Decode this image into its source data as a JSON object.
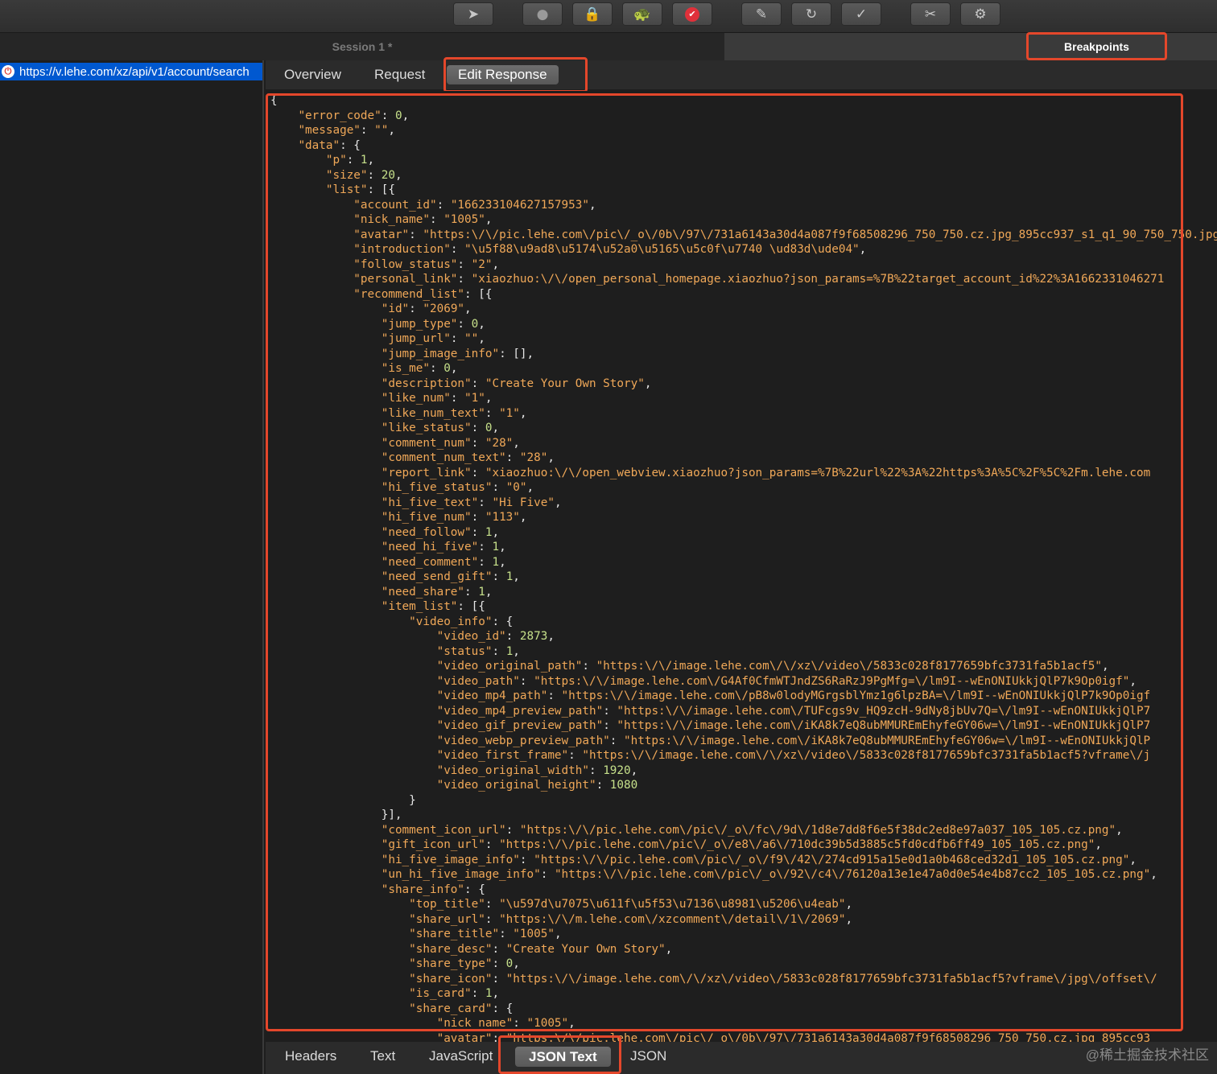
{
  "toolbar": {
    "buttons": [
      {
        "name": "pointer-icon",
        "glyph": "➤"
      },
      {
        "name": "record-icon",
        "glyph": "●"
      },
      {
        "name": "ssl-lock-icon",
        "glyph": "🔒"
      },
      {
        "name": "throttle-turtle-icon",
        "glyph": "🐢"
      },
      {
        "name": "breakpoint-stop-icon",
        "glyph": "✔"
      },
      {
        "name": "edit-pen-icon",
        "glyph": "✎"
      },
      {
        "name": "repeat-icon",
        "glyph": "↻"
      },
      {
        "name": "validate-check-icon",
        "glyph": "✓"
      },
      {
        "name": "tools-icon",
        "glyph": "✂"
      },
      {
        "name": "settings-gear-icon",
        "glyph": "⚙"
      }
    ]
  },
  "session_tab": "Session 1 *",
  "breakpoints_tab": "Breakpoints",
  "sidebar": {
    "url": "https://v.lehe.com/xz/api/v1/account/search",
    "status_icon": "⏻"
  },
  "subtabs": {
    "overview": "Overview",
    "request": "Request",
    "edit_response": "Edit Response"
  },
  "editor": {
    "lines": [
      "{",
      "    \"error_code\": 0,",
      "    \"message\": \"\",",
      "    \"data\": {",
      "        \"p\": 1,",
      "        \"size\": 20,",
      "        \"list\": [{",
      "            \"account_id\": \"166233104627157953\",",
      "            \"nick_name\": \"1005\",",
      "            \"avatar\": \"https:\\/\\/pic.lehe.com\\/pic\\/_o\\/0b\\/97\\/731a6143a30d4a087f9f68508296_750_750.cz.jpg_895cc937_s1_q1_90_750_750.jpg\",",
      "            \"introduction\": \"\\u5f88\\u9ad8\\u5174\\u52a0\\u5165\\u5c0f\\u7740 \\ud83d\\ude04\",",
      "            \"follow_status\": \"2\",",
      "            \"personal_link\": \"xiaozhuo:\\/\\/open_personal_homepage.xiaozhuo?json_params=%7B%22target_account_id%22%3A1662331046271",
      "            \"recommend_list\": [{",
      "                \"id\": \"2069\",",
      "                \"jump_type\": 0,",
      "                \"jump_url\": \"\",",
      "                \"jump_image_info\": [],",
      "                \"is_me\": 0,",
      "                \"description\": \"Create Your Own Story\",",
      "                \"like_num\": \"1\",",
      "                \"like_num_text\": \"1\",",
      "                \"like_status\": 0,",
      "                \"comment_num\": \"28\",",
      "                \"comment_num_text\": \"28\",",
      "                \"report_link\": \"xiaozhuo:\\/\\/open_webview.xiaozhuo?json_params=%7B%22url%22%3A%22https%3A%5C%2F%5C%2Fm.lehe.com",
      "                \"hi_five_status\": \"0\",",
      "                \"hi_five_text\": \"Hi Five\",",
      "                \"hi_five_num\": \"113\",",
      "                \"need_follow\": 1,",
      "                \"need_hi_five\": 1,",
      "                \"need_comment\": 1,",
      "                \"need_send_gift\": 1,",
      "                \"need_share\": 1,",
      "                \"item_list\": [{",
      "                    \"video_info\": {",
      "                        \"video_id\": 2873,",
      "                        \"status\": 1,",
      "                        \"video_original_path\": \"https:\\/\\/image.lehe.com\\/\\/xz\\/video\\/5833c028f8177659bfc3731fa5b1acf5\",",
      "                        \"video_path\": \"https:\\/\\/image.lehe.com\\/G4Af0CfmWTJndZS6RaRzJ9PgMfg=\\/lm9I--wEnONIUkkjQlP7k9Op0igf\",",
      "                        \"video_mp4_path\": \"https:\\/\\/image.lehe.com\\/pB8w0lodyMGrgsblYmz1g6lpzBA=\\/lm9I--wEnONIUkkjQlP7k9Op0igf",
      "                        \"video_mp4_preview_path\": \"https:\\/\\/image.lehe.com\\/TUFcgs9v_HQ9zcH-9dNy8jbUv7Q=\\/lm9I--wEnONIUkkjQlP7",
      "                        \"video_gif_preview_path\": \"https:\\/\\/image.lehe.com\\/iKA8k7eQ8ubMMUREmEhyfeGY06w=\\/lm9I--wEnONIUkkjQlP7",
      "                        \"video_webp_preview_path\": \"https:\\/\\/image.lehe.com\\/iKA8k7eQ8ubMMUREmEhyfeGY06w=\\/lm9I--wEnONIUkkjQlP",
      "                        \"video_first_frame\": \"https:\\/\\/image.lehe.com\\/\\/xz\\/video\\/5833c028f8177659bfc3731fa5b1acf5?vframe\\/j",
      "                        \"video_original_width\": 1920,",
      "                        \"video_original_height\": 1080",
      "                    }",
      "                }],",
      "                \"comment_icon_url\": \"https:\\/\\/pic.lehe.com\\/pic\\/_o\\/fc\\/9d\\/1d8e7dd8f6e5f38dc2ed8e97a037_105_105.cz.png\",",
      "                \"gift_icon_url\": \"https:\\/\\/pic.lehe.com\\/pic\\/_o\\/e8\\/a6\\/710dc39b5d3885c5fd0cdfb6ff49_105_105.cz.png\",",
      "                \"hi_five_image_info\": \"https:\\/\\/pic.lehe.com\\/pic\\/_o\\/f9\\/42\\/274cd915a15e0d1a0b468ced32d1_105_105.cz.png\",",
      "                \"un_hi_five_image_info\": \"https:\\/\\/pic.lehe.com\\/pic\\/_o\\/92\\/c4\\/76120a13e1e47a0d0e54e4b87cc2_105_105.cz.png\",",
      "                \"share_info\": {",
      "                    \"top_title\": \"\\u597d\\u7075\\u611f\\u5f53\\u7136\\u8981\\u5206\\u4eab\",",
      "                    \"share_url\": \"https:\\/\\/m.lehe.com\\/xzcomment\\/detail\\/1\\/2069\",",
      "                    \"share_title\": \"1005\",",
      "                    \"share_desc\": \"Create Your Own Story\",",
      "                    \"share_type\": 0,",
      "                    \"share_icon\": \"https:\\/\\/image.lehe.com\\/\\/xz\\/video\\/5833c028f8177659bfc3731fa5b1acf5?vframe\\/jpg\\/offset\\/",
      "                    \"is_card\": 1,",
      "                    \"share_card\": {",
      "                        \"nick_name\": \"1005\",",
      "                        \"avatar\": \"https:\\/\\/pic.lehe.com\\/pic\\/_o\\/0b\\/97\\/731a6143a30d4a087f9f68508296_750_750.cz.jpg_895cc93"
    ]
  },
  "bottom_tabs": {
    "headers": "Headers",
    "text": "Text",
    "javascript": "JavaScript",
    "json_text": "JSON Text",
    "json": "JSON"
  },
  "watermark": "@稀土掘金技术社区",
  "colors": {
    "accent_highlight": "#e4472b",
    "selection": "#0058d0",
    "string": "#f0a858",
    "number": "#c6e08a"
  }
}
